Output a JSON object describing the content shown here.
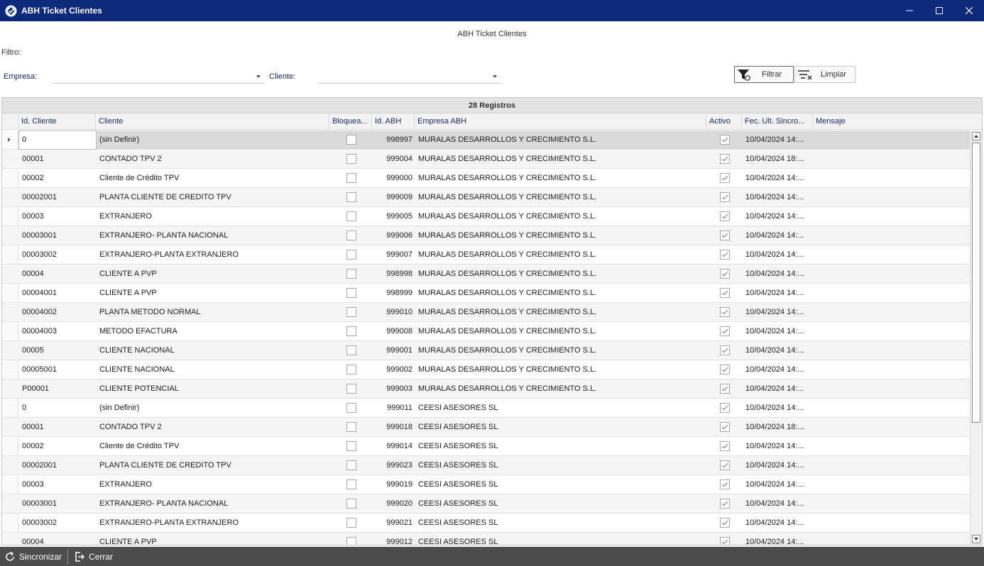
{
  "window": {
    "title": "ABH Ticket Clientes"
  },
  "page": {
    "title": "ABH Ticket Clientes",
    "filter_label": "Filtro:"
  },
  "filters": {
    "empresa_label": "Empresa:",
    "empresa_value": "",
    "cliente_label": "Cliente:",
    "cliente_value": "",
    "filtrar_label": "Filtrar",
    "limpiar_label": "Limpiar"
  },
  "grid": {
    "caption": "28 Registros",
    "columns": [
      "Id. Cliente",
      "Cliente",
      "Bloquea...",
      "Id. ABH",
      "Empresa ABH",
      "Activo",
      "Fec. Ult. Sincro...",
      "Mensaje"
    ],
    "rows": [
      {
        "id_cliente": "0",
        "cliente": "(sin Definir)",
        "bloqueado": false,
        "id_abh": "998997",
        "empresa": "MURALAS DESARROLLOS Y CRECIMIENTO S.L.",
        "activo": true,
        "fecha": "10/04/2024 14:...",
        "mensaje": ""
      },
      {
        "id_cliente": "00001",
        "cliente": "CONTADO TPV 2",
        "bloqueado": false,
        "id_abh": "999004",
        "empresa": "MURALAS DESARROLLOS Y CRECIMIENTO S.L.",
        "activo": true,
        "fecha": "10/04/2024 18:...",
        "mensaje": ""
      },
      {
        "id_cliente": "00002",
        "cliente": "Cliente de Crédito TPV",
        "bloqueado": false,
        "id_abh": "999000",
        "empresa": "MURALAS DESARROLLOS Y CRECIMIENTO S.L.",
        "activo": true,
        "fecha": "10/04/2024 14:...",
        "mensaje": ""
      },
      {
        "id_cliente": "00002001",
        "cliente": "PLANTA CLIENTE DE CREDITO TPV",
        "bloqueado": false,
        "id_abh": "999009",
        "empresa": "MURALAS DESARROLLOS Y CRECIMIENTO S.L.",
        "activo": true,
        "fecha": "10/04/2024 14:...",
        "mensaje": ""
      },
      {
        "id_cliente": "00003",
        "cliente": "EXTRANJERO",
        "bloqueado": false,
        "id_abh": "999005",
        "empresa": "MURALAS DESARROLLOS Y CRECIMIENTO S.L.",
        "activo": true,
        "fecha": "10/04/2024 14:...",
        "mensaje": ""
      },
      {
        "id_cliente": "00003001",
        "cliente": "EXTRANJERO- PLANTA NACIONAL",
        "bloqueado": false,
        "id_abh": "999006",
        "empresa": "MURALAS DESARROLLOS Y CRECIMIENTO S.L.",
        "activo": true,
        "fecha": "10/04/2024 14:...",
        "mensaje": ""
      },
      {
        "id_cliente": "00003002",
        "cliente": "EXTRANJERO-PLANTA EXTRANJERO",
        "bloqueado": false,
        "id_abh": "999007",
        "empresa": "MURALAS DESARROLLOS Y CRECIMIENTO S.L.",
        "activo": true,
        "fecha": "10/04/2024 14:...",
        "mensaje": ""
      },
      {
        "id_cliente": "00004",
        "cliente": "CLIENTE A PVP",
        "bloqueado": false,
        "id_abh": "998998",
        "empresa": "MURALAS DESARROLLOS Y CRECIMIENTO S.L.",
        "activo": true,
        "fecha": "10/04/2024 14:...",
        "mensaje": ""
      },
      {
        "id_cliente": "00004001",
        "cliente": "CLIENTE A PVP",
        "bloqueado": false,
        "id_abh": "998999",
        "empresa": "MURALAS DESARROLLOS Y CRECIMIENTO S.L.",
        "activo": true,
        "fecha": "10/04/2024 14:...",
        "mensaje": ""
      },
      {
        "id_cliente": "00004002",
        "cliente": "PLANTA METODO NORMAL",
        "bloqueado": false,
        "id_abh": "999010",
        "empresa": "MURALAS DESARROLLOS Y CRECIMIENTO S.L.",
        "activo": true,
        "fecha": "10/04/2024 14:...",
        "mensaje": ""
      },
      {
        "id_cliente": "00004003",
        "cliente": "METODO EFACTURA",
        "bloqueado": false,
        "id_abh": "999008",
        "empresa": "MURALAS DESARROLLOS Y CRECIMIENTO S.L.",
        "activo": true,
        "fecha": "10/04/2024 14:...",
        "mensaje": ""
      },
      {
        "id_cliente": "00005",
        "cliente": "CLIENTE NACIONAL",
        "bloqueado": false,
        "id_abh": "999001",
        "empresa": "MURALAS DESARROLLOS Y CRECIMIENTO S.L.",
        "activo": true,
        "fecha": "10/04/2024 14:...",
        "mensaje": ""
      },
      {
        "id_cliente": "00005001",
        "cliente": "CLIENTE NACIONAL",
        "bloqueado": false,
        "id_abh": "999002",
        "empresa": "MURALAS DESARROLLOS Y CRECIMIENTO S.L.",
        "activo": true,
        "fecha": "10/04/2024 14:...",
        "mensaje": ""
      },
      {
        "id_cliente": "P00001",
        "cliente": "CLIENTE POTENCIAL",
        "bloqueado": false,
        "id_abh": "999003",
        "empresa": "MURALAS DESARROLLOS Y CRECIMIENTO S.L.",
        "activo": true,
        "fecha": "10/04/2024 14:...",
        "mensaje": ""
      },
      {
        "id_cliente": "0",
        "cliente": "(sin Definir)",
        "bloqueado": false,
        "id_abh": "999011",
        "empresa": "CEESI ASESORES SL",
        "activo": true,
        "fecha": "10/04/2024 14:...",
        "mensaje": ""
      },
      {
        "id_cliente": "00001",
        "cliente": "CONTADO TPV 2",
        "bloqueado": false,
        "id_abh": "999018",
        "empresa": "CEESI ASESORES SL",
        "activo": true,
        "fecha": "10/04/2024 18:...",
        "mensaje": ""
      },
      {
        "id_cliente": "00002",
        "cliente": "Cliente de Crédito TPV",
        "bloqueado": false,
        "id_abh": "999014",
        "empresa": "CEESI ASESORES SL",
        "activo": true,
        "fecha": "10/04/2024 14:...",
        "mensaje": ""
      },
      {
        "id_cliente": "00002001",
        "cliente": "PLANTA CLIENTE DE CREDITO TPV",
        "bloqueado": false,
        "id_abh": "999023",
        "empresa": "CEESI ASESORES SL",
        "activo": true,
        "fecha": "10/04/2024 14:...",
        "mensaje": ""
      },
      {
        "id_cliente": "00003",
        "cliente": "EXTRANJERO",
        "bloqueado": false,
        "id_abh": "999019",
        "empresa": "CEESI ASESORES SL",
        "activo": true,
        "fecha": "10/04/2024 14:...",
        "mensaje": ""
      },
      {
        "id_cliente": "00003001",
        "cliente": "EXTRANJERO- PLANTA NACIONAL",
        "bloqueado": false,
        "id_abh": "999020",
        "empresa": "CEESI ASESORES SL",
        "activo": true,
        "fecha": "10/04/2024 14:...",
        "mensaje": ""
      },
      {
        "id_cliente": "00003002",
        "cliente": "EXTRANJERO-PLANTA EXTRANJERO",
        "bloqueado": false,
        "id_abh": "999021",
        "empresa": "CEESI ASESORES SL",
        "activo": true,
        "fecha": "10/04/2024 14:...",
        "mensaje": ""
      },
      {
        "id_cliente": "00004",
        "cliente": "CLIENTE A PVP",
        "bloqueado": false,
        "id_abh": "999012",
        "empresa": "CEESI ASESORES SL",
        "activo": true,
        "fecha": "10/04/2024 14:...",
        "mensaje": ""
      }
    ]
  },
  "bottombar": {
    "sync_label": "Sincronizar",
    "close_label": "Cerrar"
  },
  "icons": {
    "app": "app-logo-icon",
    "minimize": "minimize-icon",
    "maximize": "maximize-icon",
    "close": "close-icon",
    "filter": "filter-refresh-icon",
    "clear": "filter-clear-icon",
    "sync": "refresh-icon",
    "exit": "exit-icon"
  },
  "colors": {
    "titlebar": "#0b2a7c",
    "header_text": "#1a2b6d",
    "bottombar": "#4d4d4d"
  }
}
